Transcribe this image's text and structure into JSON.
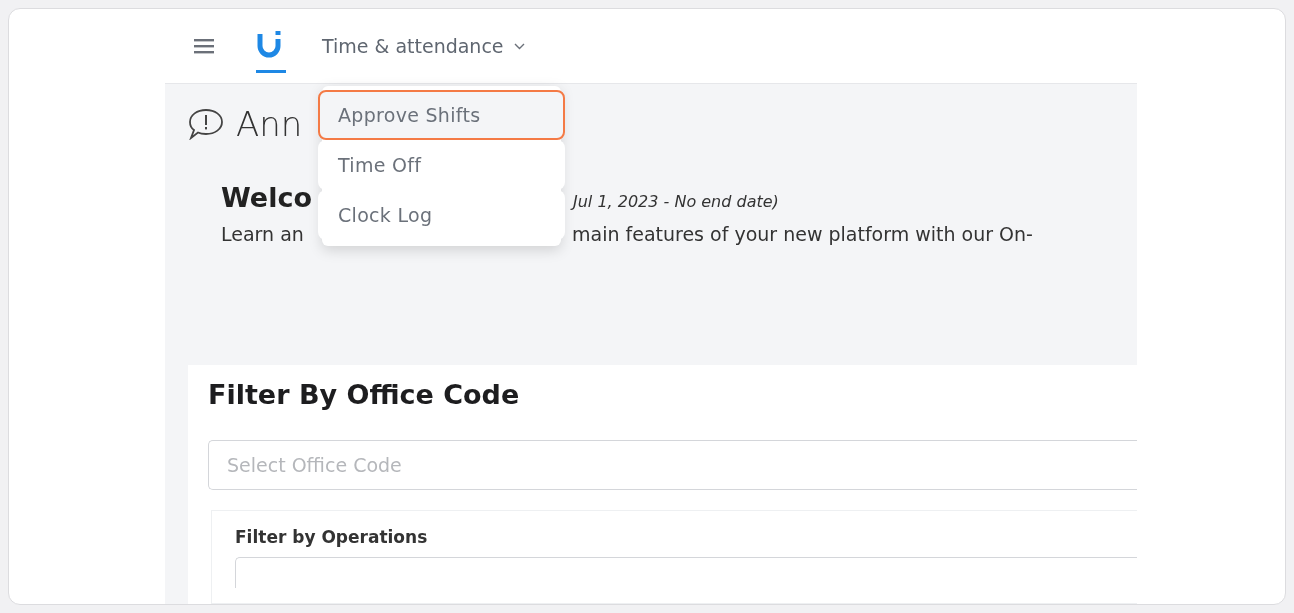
{
  "header": {
    "module": "Time & attendance",
    "menu_open": true
  },
  "menu": [
    {
      "label": "Approve Shifts",
      "highlighted": true
    },
    {
      "label": "Time Off",
      "highlighted": false
    },
    {
      "label": "Clock Log",
      "highlighted": false
    }
  ],
  "announcement": {
    "title": "Ann",
    "welcome": "Welco",
    "dates": "Jul 1, 2023 - No end date)",
    "body_start": "Learn an",
    "body_end": "main features of your new platform with our On-"
  },
  "filter": {
    "title": "Filter By Office Code",
    "office_placeholder": "Select Office Code",
    "operations_label": "Filter by Operations"
  }
}
